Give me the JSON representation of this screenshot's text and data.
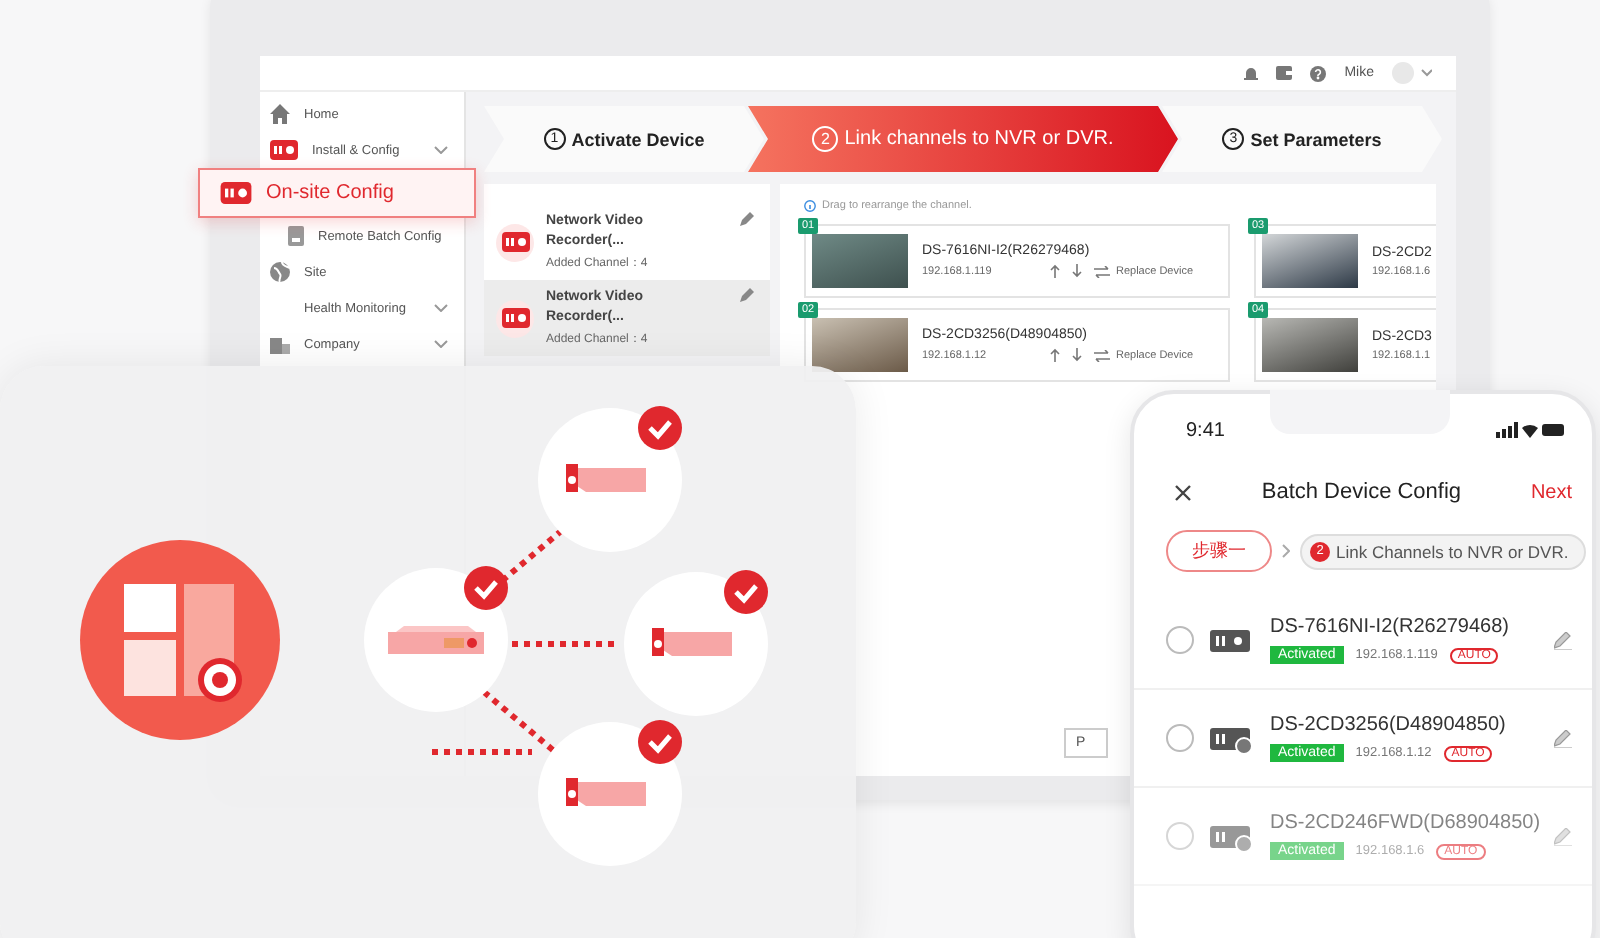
{
  "top_bar": {
    "user": "Mike"
  },
  "sidebar": {
    "items": [
      {
        "label": "Home",
        "kind": "home",
        "expandable": false,
        "selected": false
      },
      {
        "label": "Install & Config",
        "kind": "recorder",
        "expandable": true,
        "selected": false,
        "children": [
          {
            "label": "On-site Config",
            "kind": "recorder",
            "expandable": false,
            "selected": true
          },
          {
            "label": "Remote Batch Config",
            "kind": "document",
            "expandable": false,
            "selected": false
          }
        ]
      },
      {
        "label": "Site",
        "kind": "globe",
        "expandable": false,
        "selected": false
      },
      {
        "label": "Health Monitoring",
        "kind": "none",
        "expandable": true,
        "selected": false
      },
      {
        "label": "Company",
        "kind": "building",
        "expandable": true,
        "selected": false
      }
    ]
  },
  "steps": [
    {
      "number": "1",
      "label": "Activate Device",
      "selected": false
    },
    {
      "number": "2",
      "label": "Link channels to NVR or DVR.",
      "selected": true
    },
    {
      "number": "3",
      "label": "Set Parameters",
      "selected": false
    }
  ],
  "recorders": [
    {
      "name": "Network Video Recorder(...",
      "channels": "Added Channel：4",
      "selected": false
    },
    {
      "name": "Network Video Recorder(...",
      "channels": "Added Channel：4",
      "selected": true
    }
  ],
  "channel_panel": {
    "hint": "Drag to rearrange the channel.",
    "footer_button": "P",
    "channels": [
      {
        "index": "01",
        "name": "DS-7616NI-I2(R26279468)",
        "ip": "192.168.1.119",
        "action": "Replace Device"
      },
      {
        "index": "03",
        "name": "DS-2CD2",
        "ip": "192.168.1.6"
      },
      {
        "index": "02",
        "name": "DS-2CD3256(D48904850)",
        "ip": "192.168.1.12",
        "action": "Replace Device"
      },
      {
        "index": "04",
        "name": "DS-2CD3",
        "ip": "192.168.1.1"
      }
    ]
  },
  "phone": {
    "time": "9:41",
    "title": "Batch Device Config",
    "next": "Next",
    "step_label": "步骤一",
    "step_number": "2",
    "step_title": "Link Channels to NVR or DVR.",
    "devices": [
      {
        "name": "DS-7616NI-I2(R26279468)",
        "status": "Activated",
        "ip": "192.168.1.119",
        "tag": "AUTO",
        "kind": "recorder",
        "selected": false,
        "disabled": false
      },
      {
        "name": "DS-2CD3256(D48904850)",
        "status": "Activated",
        "ip": "192.168.1.12",
        "tag": "AUTO",
        "kind": "camera",
        "selected": false,
        "disabled": false
      },
      {
        "name": "DS-2CD246FWD(D68904850)",
        "status": "Activated",
        "ip": "192.168.1.6",
        "tag": "AUTO",
        "kind": "camera",
        "selected": false,
        "disabled": true
      }
    ]
  }
}
